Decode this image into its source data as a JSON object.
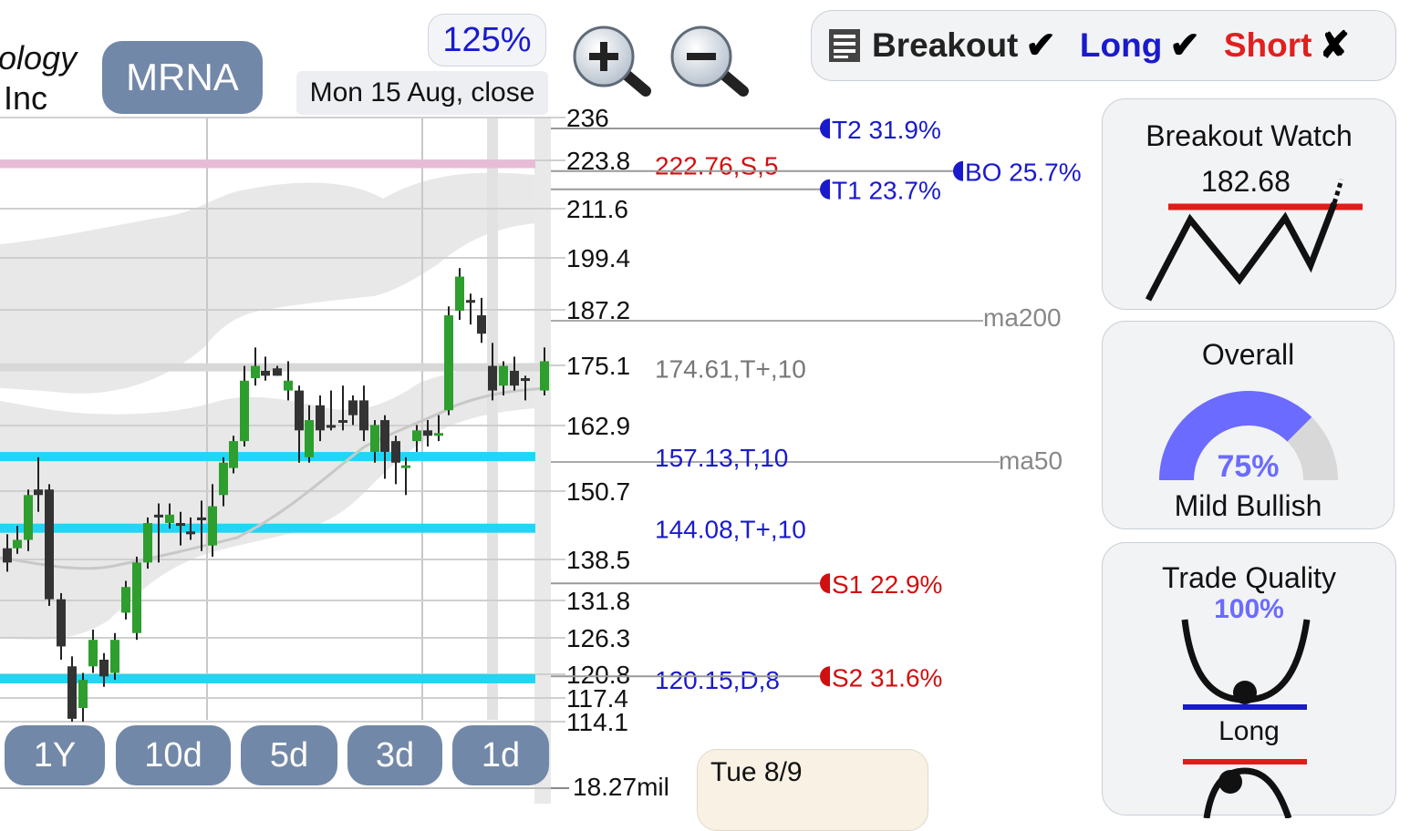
{
  "header": {
    "company_line1": "ology",
    "company_line2": "Inc",
    "ticker": "MRNA",
    "zoom": "125%",
    "date_label": "Mon 15 Aug, close",
    "zoom_in_icon": "zoom-in-icon",
    "zoom_out_icon": "zoom-out-icon"
  },
  "signals": {
    "menu_icon": "list-icon",
    "breakout": {
      "label": "Breakout",
      "mark": "✔",
      "color": "#222222"
    },
    "long": {
      "label": "Long",
      "mark": "✔",
      "color": "#1a1acd"
    },
    "short": {
      "label": "Short",
      "mark": "✘",
      "color": "#e02020"
    }
  },
  "price_axis": {
    "ticks": [
      "236",
      "223.8",
      "211.6",
      "199.4",
      "187.2",
      "175.1",
      "162.9",
      "150.7",
      "138.5",
      "131.8",
      "126.3",
      "120.8",
      "117.4",
      "114.1"
    ],
    "volume_tick": "18.27mil"
  },
  "levels": [
    {
      "text": "222.76,S,5",
      "color": "#d01010"
    },
    {
      "text": "174.61,T+,10",
      "color": "#777777"
    },
    {
      "text": "157.13,T,10",
      "color": "#1a1acd"
    },
    {
      "text": "144.08,T+,10",
      "color": "#1a1acd"
    },
    {
      "text": "120.15,D,8",
      "color": "#1a1acd"
    }
  ],
  "targets": {
    "t2": "T2 31.9%",
    "t1": "T1 23.7%",
    "bo": "BO 25.7%",
    "s1": "S1 22.9%",
    "s2": "S2 31.6%"
  },
  "ma": {
    "ma200": "ma200",
    "ma50": "ma50"
  },
  "timeframes": [
    "1Y",
    "10d",
    "5d",
    "3d",
    "1d"
  ],
  "tooltip": {
    "date": "Tue 8/9"
  },
  "breakout_watch": {
    "title": "Breakout Watch",
    "value": "182.68"
  },
  "overall": {
    "title": "Overall",
    "percent": 75,
    "percent_label": "75%",
    "sentiment": "Mild Bullish",
    "accent": "#6b6bff"
  },
  "trade_quality": {
    "title": "Trade Quality",
    "percent_label": "100%",
    "label": "Long"
  },
  "colors": {
    "bullish": "#2e9e2e",
    "bearish": "#333333",
    "support_line": "#1fd6f5",
    "resistance_line": "#e8bcd6"
  }
}
